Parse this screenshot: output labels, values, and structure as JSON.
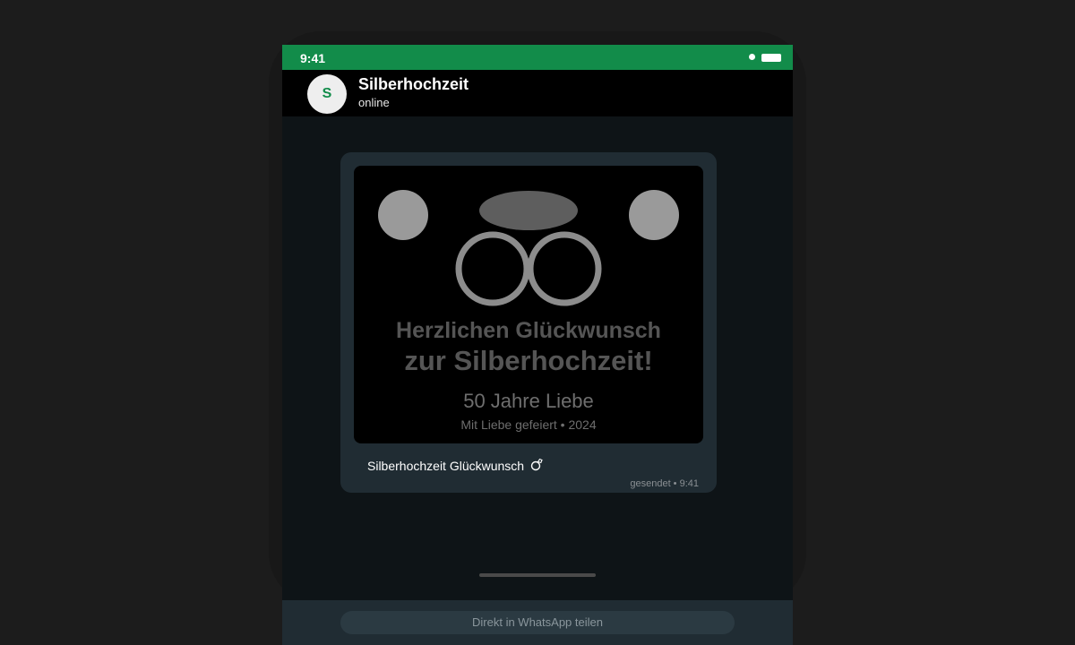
{
  "status_bar": {
    "time": "9:41"
  },
  "chat_header": {
    "avatar_initial": "S",
    "name": "Silberhochzeit",
    "status": "online"
  },
  "message": {
    "card": {
      "headline_line1": "Herzlichen Glückwunsch",
      "headline_line2": "zur Silberhochzeit!",
      "subtitle": "50 Jahre Liebe",
      "footer": "Mit Liebe gefeiert • 2024"
    },
    "caption": "Silberhochzeit Glückwunsch",
    "caption_icon": "ring-icon",
    "meta": "gesendet • 9:41"
  },
  "share": {
    "button_label": "Direkt in WhatsApp teilen"
  },
  "colors": {
    "brand_green": "#128c4a",
    "chat_background": "#0e1417",
    "bubble": "#202c33",
    "ring_silver": "#8c8c8c"
  }
}
